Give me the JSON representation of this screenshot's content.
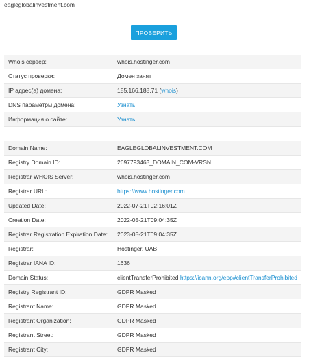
{
  "search": {
    "value": "eagleglobalinvestment.com"
  },
  "check_button": "ПРОВЕРИТЬ",
  "summary": {
    "rows": [
      {
        "label": "Whois сервер:",
        "value": "whois.hostinger.com"
      },
      {
        "label": "Статус проверки:",
        "value": "Домен занят"
      },
      {
        "label": "IP адрес(а) домена:",
        "value": "185.166.188.71",
        "paren_open": " (",
        "link": "whois",
        "paren_close": ")"
      },
      {
        "label": "DNS параметры домена:",
        "link": "Узнать"
      },
      {
        "label": "Информация о сайте:",
        "link": "Узнать"
      }
    ]
  },
  "whois": {
    "rows": [
      {
        "label": "Domain Name:",
        "value": "EAGLEGLOBALINVESTMENT.COM"
      },
      {
        "label": "Registry Domain ID:",
        "value": "2697793463_DOMAIN_COM-VRSN"
      },
      {
        "label": "Registrar WHOIS Server:",
        "value": "whois.hostinger.com"
      },
      {
        "label": "Registrar URL:",
        "link": "https://www.hostinger.com"
      },
      {
        "label": "Updated Date:",
        "value": "2022-07-21T02:16:01Z"
      },
      {
        "label": "Creation Date:",
        "value": "2022-05-21T09:04:35Z"
      },
      {
        "label": "Registrar Registration Expiration Date:",
        "value": "2023-05-21T09:04:35Z"
      },
      {
        "label": "Registrar:",
        "value": "Hostinger, UAB"
      },
      {
        "label": "Registrar IANA ID:",
        "value": "1636"
      },
      {
        "label": "Domain Status:",
        "value": "clientTransferProhibited ",
        "link": "https://icann.org/epp#clientTransferProhibited"
      },
      {
        "label": "Registry Registrant ID:",
        "value": "GDPR Masked"
      },
      {
        "label": "Registrant Name:",
        "value": "GDPR Masked"
      },
      {
        "label": "Registrant Organization:",
        "value": "GDPR Masked"
      },
      {
        "label": "Registrant Street:",
        "value": "GDPR Masked"
      },
      {
        "label": "Registrant City:",
        "value": "GDPR Masked"
      }
    ]
  }
}
